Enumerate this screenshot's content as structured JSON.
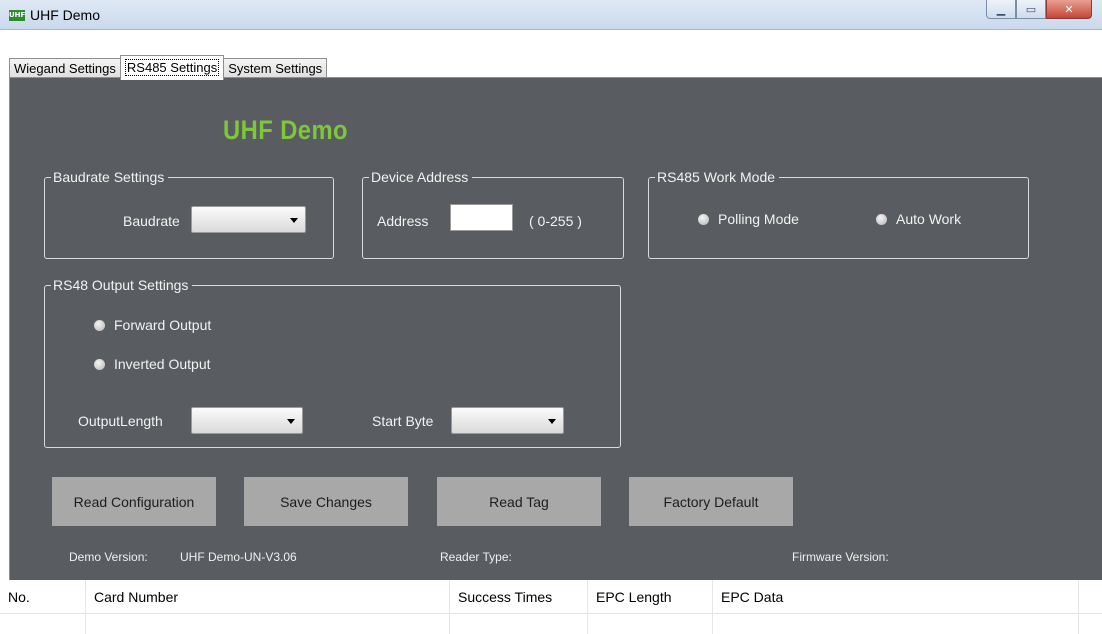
{
  "window": {
    "title": "UHF Demo",
    "icon_text": "UHF",
    "minimize_glyph": "▁",
    "maximize_glyph": "▭",
    "close_glyph": "✕"
  },
  "tabs": [
    {
      "label": "Wiegand Settings",
      "active": false
    },
    {
      "label": "RS485 Settings",
      "active": true
    },
    {
      "label": "System Settings",
      "active": false
    }
  ],
  "brand": {
    "text": "UHF Demo",
    "color": "#7ec63a"
  },
  "baudrate": {
    "group_title": "Baudrate Settings",
    "label": "Baudrate",
    "value": ""
  },
  "device_address": {
    "group_title": "Device Address",
    "label": "Address",
    "value": "",
    "range": "( 0-255 )"
  },
  "work_mode": {
    "group_title": "RS485 Work Mode",
    "options": [
      "Polling Mode",
      "Auto Work"
    ]
  },
  "output": {
    "group_title": "RS48 Output Settings",
    "options": [
      "Forward Output",
      "Inverted Output"
    ],
    "length_label": "OutputLength",
    "length_value": "",
    "start_byte_label": "Start Byte",
    "start_byte_value": ""
  },
  "buttons": {
    "read_config": "Read Configuration",
    "save": "Save Changes",
    "read_tag": "Read Tag",
    "factory": "Factory Default"
  },
  "info": {
    "demo_version_label": "Demo Version:",
    "demo_version_value": "UHF Demo-UN-V3.06",
    "reader_type_label": "Reader Type:",
    "firmware_label": "Firmware Version:"
  },
  "table": {
    "columns": [
      "No.",
      "Card Number",
      "Success Times",
      "EPC Length",
      "EPC Data"
    ]
  },
  "colors": {
    "panel": "#595c60",
    "button": "#a8a8a8",
    "accent_green": "#7ec63a"
  }
}
